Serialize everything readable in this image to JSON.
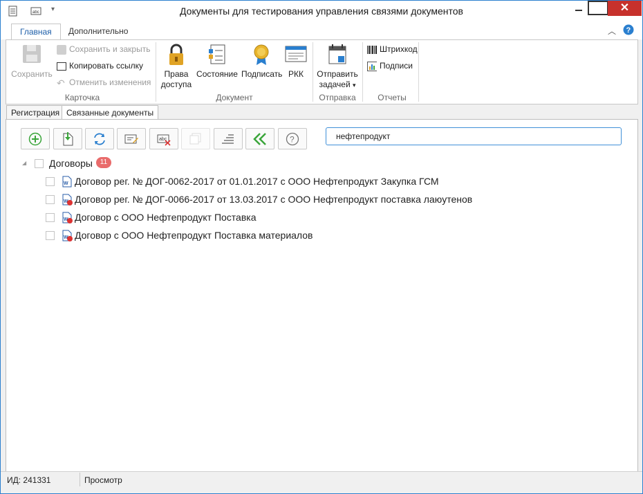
{
  "window": {
    "title": "Документы для тестирования управления связями документов",
    "close_glyph": "✕"
  },
  "ribbon_tabs": [
    "Главная",
    "Дополнительно"
  ],
  "ribbon": {
    "card_group": {
      "label": "Карточка",
      "save": "Сохранить",
      "save_close": "Сохранить и закрыть",
      "copy_link": "Копировать ссылку",
      "undo_changes": "Отменить изменения"
    },
    "document_group": {
      "label": "Документ",
      "access_line1": "Права",
      "access_line2": "доступа",
      "state": "Состояние",
      "sign": "Подписать",
      "rkk": "РКК"
    },
    "send_group": {
      "label": "Отправка",
      "send_line1": "Отправить",
      "send_line2": "задачей"
    },
    "reports_group": {
      "label": "Отчеты",
      "barcode": "Штрихкод",
      "signatures": "Подписи"
    }
  },
  "doc_tabs": [
    "Регистрация",
    "Связанные документы"
  ],
  "search": {
    "value": "нефтепродукт"
  },
  "tree": {
    "group_label": "Договоры",
    "group_count": "11",
    "items": [
      "Договор рег. № ДОГ-0062-2017 от 01.01.2017 с ООО Нефтепродукт Закупка ГСМ",
      "Договор рег. № ДОГ-0066-2017 от 13.03.2017 с ООО Нефтепродукт поставка лаюутенов",
      "Договор с ООО Нефтепродукт Поставка",
      "Договор с ООО Нефтепродукт Поставка материалов"
    ]
  },
  "status": {
    "id": "ИД: 241331",
    "mode": "Просмотр"
  },
  "colors": {
    "accent": "#2a7fcf",
    "close": "#c7312c",
    "badge": "#e96b6b",
    "green": "#3aa53a"
  },
  "icons": {
    "toolbar": [
      "add-icon",
      "import-icon",
      "refresh-icon",
      "edit-icon",
      "delete-icon",
      "copy-icon",
      "align-icon",
      "collapse-icon",
      "help-icon"
    ]
  }
}
